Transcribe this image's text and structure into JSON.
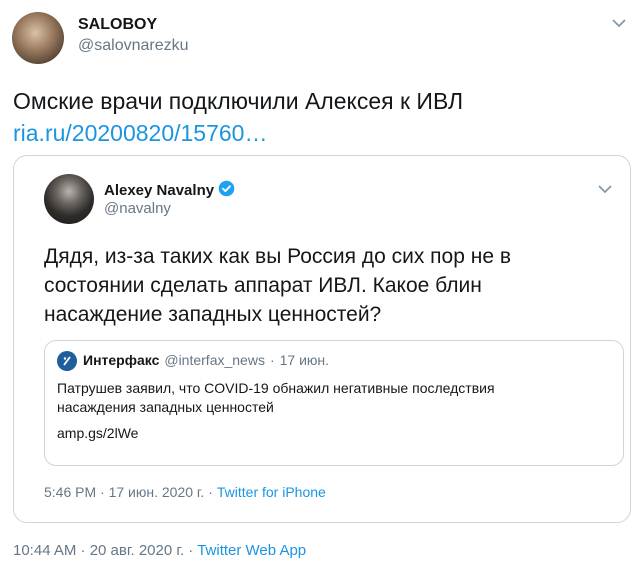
{
  "main_tweet": {
    "author_name": "SALOBOY",
    "author_handle": "@salovnarezku",
    "text": "Омские врачи подключили Алексея к ИВЛ",
    "link": "ria.ru/20200820/15760…",
    "timestamp": "10:44 AM · 20 авг. 2020 г.",
    "separator": "·",
    "source": "Twitter Web App"
  },
  "quoted_tweet": {
    "author_name": "Alexey Navalny",
    "author_handle": "@navalny",
    "text": "Дядя, из-за таких как вы Россия до сих пор не в состоянии сделать аппарат ИВЛ. Какое блин насаждение западных ценностей?",
    "timestamp": "5:46 PM · 17 июн. 2020 г.",
    "separator": "·",
    "source": "Twitter for iPhone"
  },
  "nested_tweet": {
    "author_name": "Интерфакс",
    "author_handle": "@interfax_news",
    "separator": "·",
    "date": "17 июн.",
    "text": "Патрушев заявил, что COVID-19 обнажил негативные последствия насаждения западных ценностей",
    "link": "amp.gs/2lWe"
  },
  "icons": {
    "verified_badge": "verified-icon",
    "caret": "chevron-down-icon",
    "interfax_logo": "interfax-logo-icon"
  },
  "colors": {
    "link": "#1b95e0",
    "secondary_text": "#657786",
    "border": "#ccd6dd",
    "verified": "#1da1f2"
  }
}
